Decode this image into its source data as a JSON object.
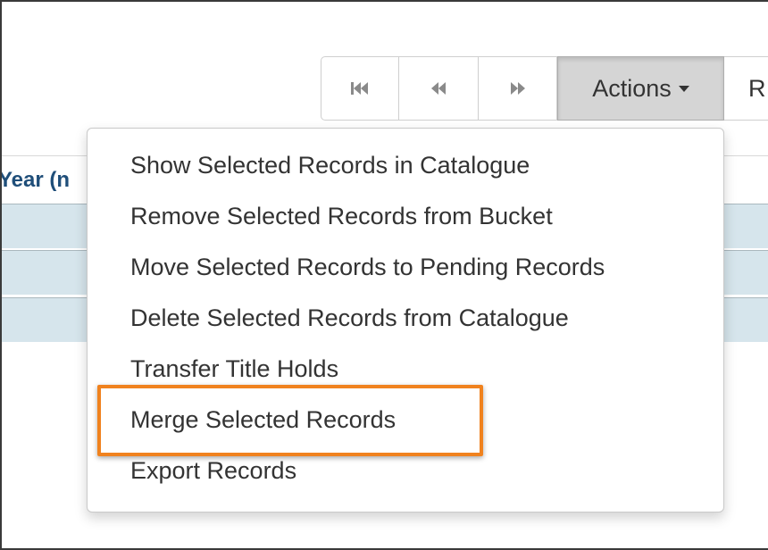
{
  "toolbar": {
    "buttons": [
      {
        "icon": "first-page-icon"
      },
      {
        "icon": "previous-page-icon"
      },
      {
        "icon": "next-page-icon"
      }
    ],
    "actions_label": "Actions",
    "next_button_partial": "R"
  },
  "table": {
    "column_header_partial": "Year (n"
  },
  "actions_menu": {
    "items": [
      "Show Selected Records in Catalogue",
      "Remove Selected Records from Bucket",
      "Move Selected Records to Pending Records",
      "Delete Selected Records from Catalogue",
      "Transfer Title Holds",
      "Merge Selected Records",
      "Export Records"
    ],
    "highlighted_item": "Merge Selected Records"
  },
  "colors": {
    "highlight_border": "#f0821e",
    "row_background": "#d6e5ec",
    "active_button": "#d5d5d5"
  }
}
